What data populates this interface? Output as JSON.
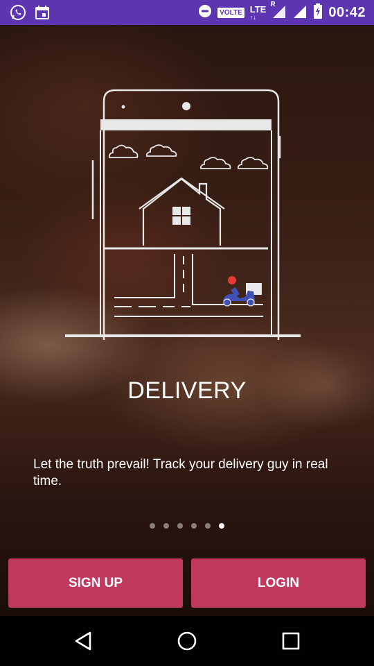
{
  "status_bar": {
    "time": "00:42",
    "volte": "VOLTE",
    "lte": "LTE",
    "roaming": "R",
    "icons": [
      "whatsapp-icon",
      "calendar-icon",
      "do-not-disturb-icon",
      "signal-icon",
      "battery-charging-icon"
    ]
  },
  "onboarding": {
    "title": "DELIVERY",
    "description": "Let the truth prevail! Track your delivery guy in real time.",
    "page_count": 6,
    "active_page_index": 5
  },
  "buttons": {
    "signup_label": "SIGN UP",
    "login_label": "LOGIN"
  },
  "colors": {
    "status_bar": "#5e35b1",
    "button": "#c2395f",
    "scooter": "#3f51b5",
    "helmet": "#e53935"
  },
  "nav": {
    "icons": [
      "back-icon",
      "home-icon",
      "recents-icon"
    ]
  }
}
